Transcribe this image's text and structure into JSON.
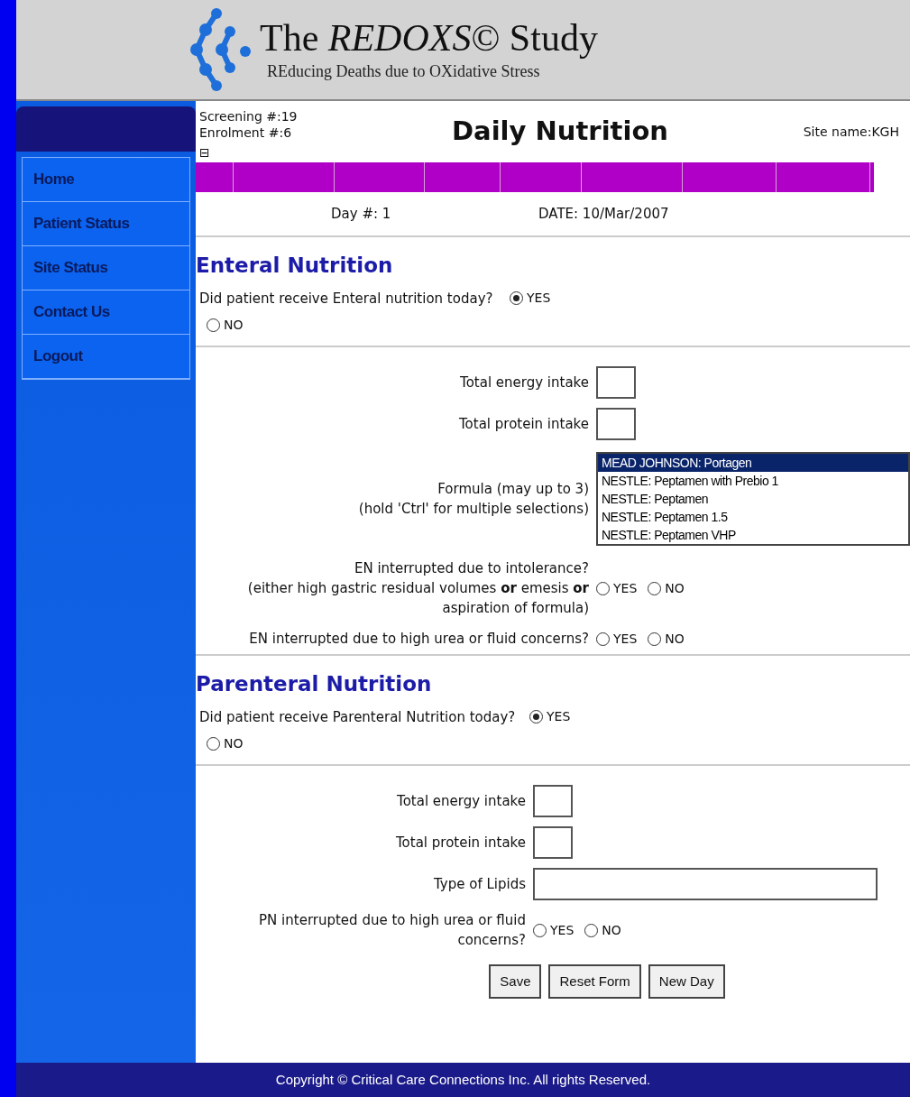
{
  "header": {
    "title_start": "The ",
    "title_italic": "REDOXS",
    "title_end": "© Study",
    "subtitle": "REducing Deaths due to OXidative Stress"
  },
  "sidebar": {
    "items": [
      {
        "label": "Home"
      },
      {
        "label": "Patient Status"
      },
      {
        "label": "Site Status"
      },
      {
        "label": "Contact Us"
      },
      {
        "label": "Logout"
      }
    ]
  },
  "info": {
    "screening": "Screening #:19",
    "enrolment": "Enrolment #:6",
    "page_title": "Daily Nutrition",
    "site": "Site name:KGH",
    "collapse": "⊟"
  },
  "day": {
    "day": "Day #: 1",
    "date": "DATE: 10/Mar/2007"
  },
  "sections": [
    {
      "title": "Enteral Nutrition",
      "question": "Did patient receive Enteral nutrition today?",
      "options": [
        {
          "label": "YES",
          "selected": true
        },
        {
          "label": "NO",
          "selected": false
        }
      ],
      "fields": [
        {
          "kind": "input",
          "label": "Total energy intake"
        },
        {
          "kind": "input",
          "label": "Total protein intake"
        },
        {
          "kind": "listbox",
          "label": "Formula (may up to 3)\n(hold 'Ctrl' for multiple selections)",
          "options": [
            {
              "label": "MEAD JOHNSON: Portagen",
              "selected": true
            },
            {
              "label": "NESTLE: Peptamen with Prebio 1",
              "selected": false
            },
            {
              "label": "NESTLE: Peptamen",
              "selected": false
            },
            {
              "label": "NESTLE: Peptamen 1.5",
              "selected": false
            },
            {
              "label": "NESTLE: Peptamen VHP",
              "selected": false
            }
          ]
        },
        {
          "kind": "radio",
          "label": "EN interrupted due to intolerance?\n(either high gastric residual volumes **or** emesis **or**\naspiration of formula)",
          "options": [
            {
              "label": "YES",
              "selected": false
            },
            {
              "label": "NO",
              "selected": false
            }
          ]
        },
        {
          "kind": "radio",
          "label": "EN interrupted due to high urea or fluid concerns?",
          "options": [
            {
              "label": "YES",
              "selected": false
            },
            {
              "label": "NO",
              "selected": false
            }
          ]
        }
      ]
    },
    {
      "title": "Parenteral Nutrition",
      "question": "Did patient receive Parenteral Nutrition today?",
      "options": [
        {
          "label": "YES",
          "selected": true
        },
        {
          "label": "NO",
          "selected": false
        }
      ],
      "fields": [
        {
          "kind": "input",
          "label": "Total energy intake"
        },
        {
          "kind": "input",
          "label": "Total protein intake"
        },
        {
          "kind": "wide-input",
          "label": "Type of Lipids"
        },
        {
          "kind": "radio",
          "label": "PN interrupted due to high urea or fluid concerns?",
          "options": [
            {
              "label": "YES",
              "selected": false
            },
            {
              "label": "NO",
              "selected": false
            }
          ]
        }
      ]
    }
  ],
  "buttons": [
    "Save",
    "Reset Form",
    "New Day"
  ],
  "footer": "Copyright © Critical Care Connections Inc. All rights Reserved."
}
